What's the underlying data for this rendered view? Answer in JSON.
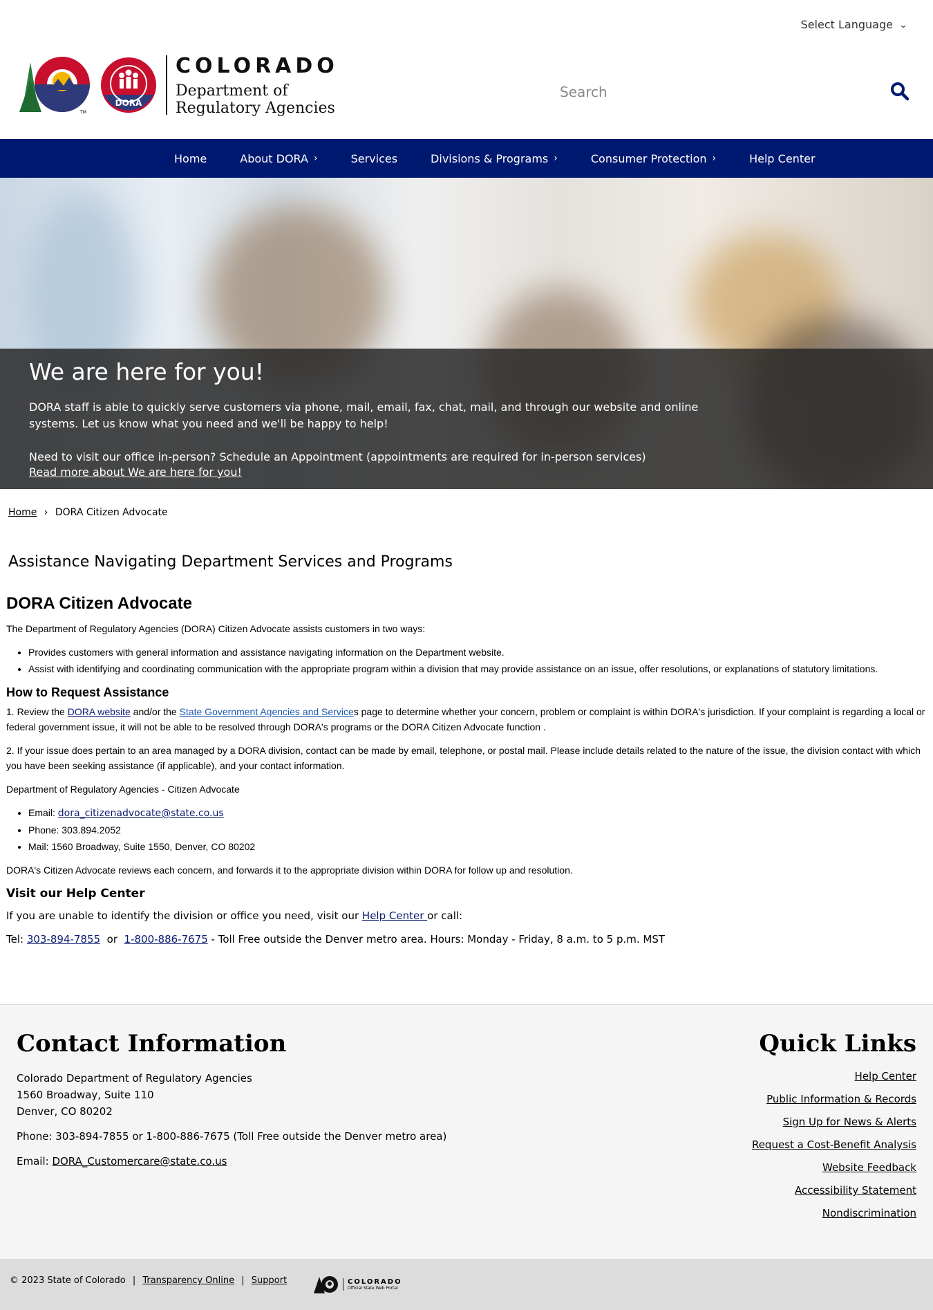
{
  "language": {
    "label": "Select Language"
  },
  "header": {
    "state_name": "COLORADO",
    "dept_line1": "Department of",
    "dept_line2": "Regulatory Agencies",
    "dora_badge": "DORA",
    "tm": "TM",
    "search_placeholder": "Search"
  },
  "nav": {
    "items": [
      {
        "label": "Home",
        "has_sub": false
      },
      {
        "label": "About DORA",
        "has_sub": true
      },
      {
        "label": "Services",
        "has_sub": false
      },
      {
        "label": "Divisions & Programs",
        "has_sub": true
      },
      {
        "label": "Consumer Protection",
        "has_sub": true
      },
      {
        "label": "Help Center",
        "has_sub": false
      }
    ],
    "carat": "›"
  },
  "hero": {
    "title": "We are here for you!",
    "p1": "DORA staff is able to quickly serve customers via phone, mail, email, fax, chat, mail, and through our website and online systems. Let us know what you need and we'll be happy to help!",
    "p2": "Need to visit our office in-person? Schedule an Appointment (appointments are required for in-person services)",
    "link": "Read more about We are here for you!"
  },
  "breadcrumb": {
    "home": "Home",
    "sep": "›",
    "current": "DORA Citizen Advocate"
  },
  "page_title": "Assistance Navigating Department Services and Programs",
  "content": {
    "h2": "DORA Citizen Advocate",
    "intro": "The Department of Regulatory Agencies (DORA) Citizen Advocate assists customers in two ways:",
    "bullets": [
      "Provides customers with general information and  assistance navigating information on the Department website.",
      "Assist with identifying and coordinating communication with the appropriate program within a division that may provide assistance on an issue, offer resolutions, or explanations of statutory limitations."
    ],
    "h3": "How to Request Assistance",
    "step1_a": "1. Review the ",
    "step1_link1": "DORA website",
    "step1_b": " and/or the ",
    "step1_link2": "State Government Agencies and Service",
    "step1_c": "s page to determine whether your concern, problem or complaint is within DORA's jurisdiction. If your complaint is regarding a local or federal government issue, it will not be able to be resolved through DORA's programs or the DORA Citizen Advocate function .",
    "step2": "2. If your issue does pertain to an area managed by a DORA division, contact can be made by email, telephone, or postal mail. Please include details related to the nature of the issue, the division contact with which you have been seeking assistance (if applicable), and your contact information.",
    "advocate_heading": "Department of Regulatory Agencies - Citizen Advocate",
    "email_label": "Email: ",
    "email": "dora_citizenadvocate@state.co.us",
    "phone": "Phone: 303.894.2052",
    "mail": "Mail: 1560 Broadway, Suite 1550, Denver, CO 80202",
    "review": "DORA's Citizen Advocate reviews each concern, and forwards it to the appropriate division within DORA for follow up and resolution.",
    "visit_h": "Visit our Help Center",
    "visit_a": "If you are unable to identify the division or office you need, visit our ",
    "visit_link": "Help Center ",
    "visit_b": "or call:",
    "tel_label": "Tel:  ",
    "tel1": "303-894-7855",
    "tel_or": "  or  ",
    "tel2": "1-800-886-7675",
    "tel_rest": " - Toll Free outside the Denver metro area. Hours:  Monday - Friday, 8 a.m. to 5 p.m. MST"
  },
  "footer": {
    "contact_title": "Contact Information",
    "addr1": "Colorado Department of Regulatory Agencies",
    "addr2": "1560 Broadway, Suite 110",
    "addr3": "Denver, CO 80202",
    "phone": "Phone: 303-894-7855 or 1-800-886-7675 (Toll Free outside the Denver metro area)",
    "email_label": "Email: ",
    "email": "DORA_Customercare@state.co.us",
    "quick_title": "Quick Links",
    "links": [
      "Help Center",
      "Public Information & Records",
      "Sign Up for News & Alerts",
      "Request a Cost-Benefit Analysis",
      "Website Feedback",
      "Accessibility Statement",
      "Nondiscrimination"
    ]
  },
  "bottom": {
    "copyright": "© 2023 State of Colorado",
    "sep": "|",
    "transparency": "Transparency Online",
    "support": "Support",
    "portal_name": "COLORADO",
    "portal_sub": "Official State Web Portal"
  },
  "colors": {
    "nav": "#001970",
    "co_red": "#c8102e",
    "co_blue": "#2e3a7a",
    "co_gold": "#f2b500",
    "tree": "#2a7a3a"
  }
}
